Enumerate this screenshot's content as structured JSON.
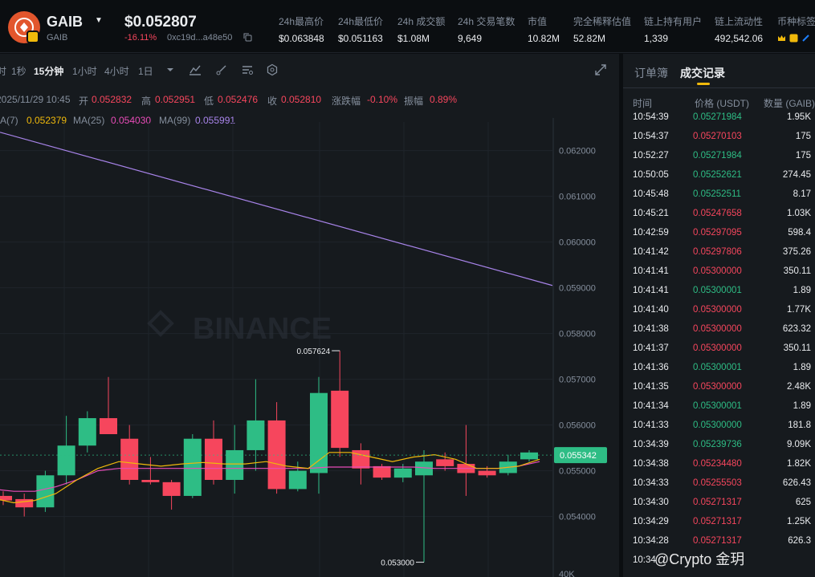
{
  "header": {
    "symbol": "GAIB",
    "symbol_sub": "GAIB",
    "price": "$0.052807",
    "change": "-16.11%",
    "address": "0xc19d...a48e50",
    "stats": [
      {
        "label": "24h最高价",
        "value": "$0.063848"
      },
      {
        "label": "24h最低价",
        "value": "$0.051163"
      },
      {
        "label": "24h 成交额",
        "value": "$1.08M"
      },
      {
        "label": "24h 交易笔数",
        "value": "9,649"
      },
      {
        "label": "市值",
        "value": "10.82M"
      },
      {
        "label": "完全稀释估值",
        "value": "52.82M"
      },
      {
        "label": "链上持有用户",
        "value": "1,339"
      },
      {
        "label": "链上流动性",
        "value": "492,542.06"
      },
      {
        "label": "币种标签",
        "value": ""
      }
    ],
    "colors": {
      "brand": "#e2562d",
      "accent": "#f0b90b",
      "up": "#2ebd85",
      "down": "#f6465d"
    }
  },
  "toolbar": {
    "items": [
      "1秒",
      "15分钟",
      "1小时",
      "4小时",
      "1日"
    ],
    "active": "15分钟",
    "icons": [
      "chevron-down-icon",
      "indicator-icon",
      "drawing-icon",
      "settings-icon",
      "hexagon-icon",
      "expand-icon"
    ]
  },
  "ohlc": {
    "datetime": "2025/11/29 10:45",
    "open_label": "开",
    "open": "0.052832",
    "high_label": "高",
    "high": "0.052951",
    "low_label": "低",
    "low": "0.052476",
    "close_label": "收",
    "close": "0.052810",
    "chg_label": "涨跌幅",
    "chg": "-0.10%",
    "amp_label": "振幅",
    "amp": "0.89%"
  },
  "ma": {
    "ma7_label": "MA(7)",
    "ma7": "0.052379",
    "ma7_color": "#f0b90b",
    "ma25_label": "MA(25)",
    "ma25": "0.054030",
    "ma25_color": "#e84cb8",
    "ma99_label": "MA(99)",
    "ma99": "0.055991",
    "ma99_color": "#a884ea"
  },
  "chart_data": {
    "type": "candlestick",
    "y_ticks": [
      "0.062000",
      "0.061000",
      "0.060000",
      "0.059000",
      "0.058000",
      "0.057000",
      "0.056000",
      "0.055000",
      "0.054000"
    ],
    "ylim": [
      0.0528,
      0.0628
    ],
    "current_price": "0.055342",
    "high_marker": "0.057624",
    "low_marker": "0.053000",
    "volume_tick": "40K",
    "watermark": "BINANCE",
    "candles": [
      {
        "o": 0.05445,
        "h": 0.05455,
        "l": 0.05425,
        "c": 0.05435
      },
      {
        "o": 0.05438,
        "h": 0.0545,
        "l": 0.054,
        "c": 0.0542
      },
      {
        "o": 0.0542,
        "h": 0.055,
        "l": 0.0541,
        "c": 0.0549
      },
      {
        "o": 0.0549,
        "h": 0.0562,
        "l": 0.0547,
        "c": 0.05555
      },
      {
        "o": 0.05555,
        "h": 0.0563,
        "l": 0.0554,
        "c": 0.05615
      },
      {
        "o": 0.05615,
        "h": 0.05705,
        "l": 0.0558,
        "c": 0.0558
      },
      {
        "o": 0.0557,
        "h": 0.056,
        "l": 0.0547,
        "c": 0.0548
      },
      {
        "o": 0.0548,
        "h": 0.0553,
        "l": 0.0547,
        "c": 0.05475
      },
      {
        "o": 0.05475,
        "h": 0.0548,
        "l": 0.05415,
        "c": 0.05445
      },
      {
        "o": 0.05445,
        "h": 0.0558,
        "l": 0.0544,
        "c": 0.0557
      },
      {
        "o": 0.0557,
        "h": 0.0561,
        "l": 0.0547,
        "c": 0.0548
      },
      {
        "o": 0.0548,
        "h": 0.056,
        "l": 0.0545,
        "c": 0.05545
      },
      {
        "o": 0.05545,
        "h": 0.057,
        "l": 0.055,
        "c": 0.0561
      },
      {
        "o": 0.0561,
        "h": 0.0565,
        "l": 0.0545,
        "c": 0.0546
      },
      {
        "o": 0.0546,
        "h": 0.0552,
        "l": 0.05455,
        "c": 0.055
      },
      {
        "o": 0.05495,
        "h": 0.05705,
        "l": 0.0545,
        "c": 0.0567
      },
      {
        "o": 0.05675,
        "h": 0.05762,
        "l": 0.0553,
        "c": 0.0555
      },
      {
        "o": 0.05545,
        "h": 0.0556,
        "l": 0.0547,
        "c": 0.05505
      },
      {
        "o": 0.0551,
        "h": 0.05515,
        "l": 0.0548,
        "c": 0.05485
      },
      {
        "o": 0.05485,
        "h": 0.05515,
        "l": 0.05475,
        "c": 0.05505
      },
      {
        "o": 0.0549,
        "h": 0.05545,
        "l": 0.053,
        "c": 0.0552
      },
      {
        "o": 0.05525,
        "h": 0.0554,
        "l": 0.055,
        "c": 0.0551
      },
      {
        "o": 0.05515,
        "h": 0.056,
        "l": 0.05445,
        "c": 0.05495
      },
      {
        "o": 0.055,
        "h": 0.0551,
        "l": 0.05485,
        "c": 0.0549
      },
      {
        "o": 0.05495,
        "h": 0.05535,
        "l": 0.0549,
        "c": 0.0552
      },
      {
        "o": 0.05525,
        "h": 0.05545,
        "l": 0.0552,
        "c": 0.0554
      }
    ],
    "ma7": [
      0.0544,
      0.0543,
      0.05435,
      0.0545,
      0.0548,
      0.05505,
      0.0552,
      0.05515,
      0.0551,
      0.05515,
      0.05518,
      0.05515,
      0.05515,
      0.0552,
      0.0551,
      0.05505,
      0.0554,
      0.0554,
      0.0553,
      0.0552,
      0.0553,
      0.05535,
      0.05525,
      0.05505,
      0.05505,
      0.0551,
      0.05525
    ],
    "ma25": [
      0.0546,
      0.05455,
      0.05455,
      0.05465,
      0.0548,
      0.055,
      0.05505,
      0.05505,
      0.05505,
      0.05505,
      0.05505,
      0.05505,
      0.05505,
      0.05505,
      0.05505,
      0.05505,
      0.05508,
      0.05508,
      0.05508,
      0.05508,
      0.05508,
      0.05505,
      0.05505,
      0.05505,
      0.05505,
      0.0551,
      0.0552
    ],
    "ma99": {
      "start": 0.0624,
      "end": 0.05905
    }
  },
  "trades": {
    "tabs": [
      "订单簿",
      "成交记录"
    ],
    "active_tab": "成交记录",
    "headers": [
      "时间",
      "价格 (USDT)",
      "数量 (GAIB)"
    ],
    "rows": [
      {
        "time": "10:54:39",
        "price": "0.05271984",
        "qty": "1.95K",
        "side": "up"
      },
      {
        "time": "10:54:37",
        "price": "0.05270103",
        "qty": "175",
        "side": "down"
      },
      {
        "time": "10:52:27",
        "price": "0.05271984",
        "qty": "175",
        "side": "up"
      },
      {
        "time": "10:50:05",
        "price": "0.05252621",
        "qty": "274.45",
        "side": "up"
      },
      {
        "time": "10:45:48",
        "price": "0.05252511",
        "qty": "8.17",
        "side": "up"
      },
      {
        "time": "10:45:21",
        "price": "0.05247658",
        "qty": "1.03K",
        "side": "down"
      },
      {
        "time": "10:42:59",
        "price": "0.05297095",
        "qty": "598.4",
        "side": "down"
      },
      {
        "time": "10:41:42",
        "price": "0.05297806",
        "qty": "375.26",
        "side": "down"
      },
      {
        "time": "10:41:41",
        "price": "0.05300000",
        "qty": "350.11",
        "side": "down"
      },
      {
        "time": "10:41:41",
        "price": "0.05300001",
        "qty": "1.89",
        "side": "up"
      },
      {
        "time": "10:41:40",
        "price": "0.05300000",
        "qty": "1.77K",
        "side": "down"
      },
      {
        "time": "10:41:38",
        "price": "0.05300000",
        "qty": "623.32",
        "side": "down"
      },
      {
        "time": "10:41:37",
        "price": "0.05300000",
        "qty": "350.11",
        "side": "down"
      },
      {
        "time": "10:41:36",
        "price": "0.05300001",
        "qty": "1.89",
        "side": "up"
      },
      {
        "time": "10:41:35",
        "price": "0.05300000",
        "qty": "2.48K",
        "side": "down"
      },
      {
        "time": "10:41:34",
        "price": "0.05300001",
        "qty": "1.89",
        "side": "up"
      },
      {
        "time": "10:41:33",
        "price": "0.05300000",
        "qty": "181.8",
        "side": "up"
      },
      {
        "time": "10:34:39",
        "price": "0.05239736",
        "qty": "9.09K",
        "side": "up"
      },
      {
        "time": "10:34:38",
        "price": "0.05234480",
        "qty": "1.82K",
        "side": "down"
      },
      {
        "time": "10:34:33",
        "price": "0.05255503",
        "qty": "626.43",
        "side": "down"
      },
      {
        "time": "10:34:30",
        "price": "0.05271317",
        "qty": "625",
        "side": "down"
      },
      {
        "time": "10:34:29",
        "price": "0.05271317",
        "qty": "1.25K",
        "side": "down"
      },
      {
        "time": "10:34:28",
        "price": "0.05271317",
        "qty": "626.3",
        "side": "down"
      },
      {
        "time": "10:34",
        "price": "",
        "qty": "",
        "side": "down"
      }
    ]
  },
  "footer_watermark": "@Crypto 金玥"
}
